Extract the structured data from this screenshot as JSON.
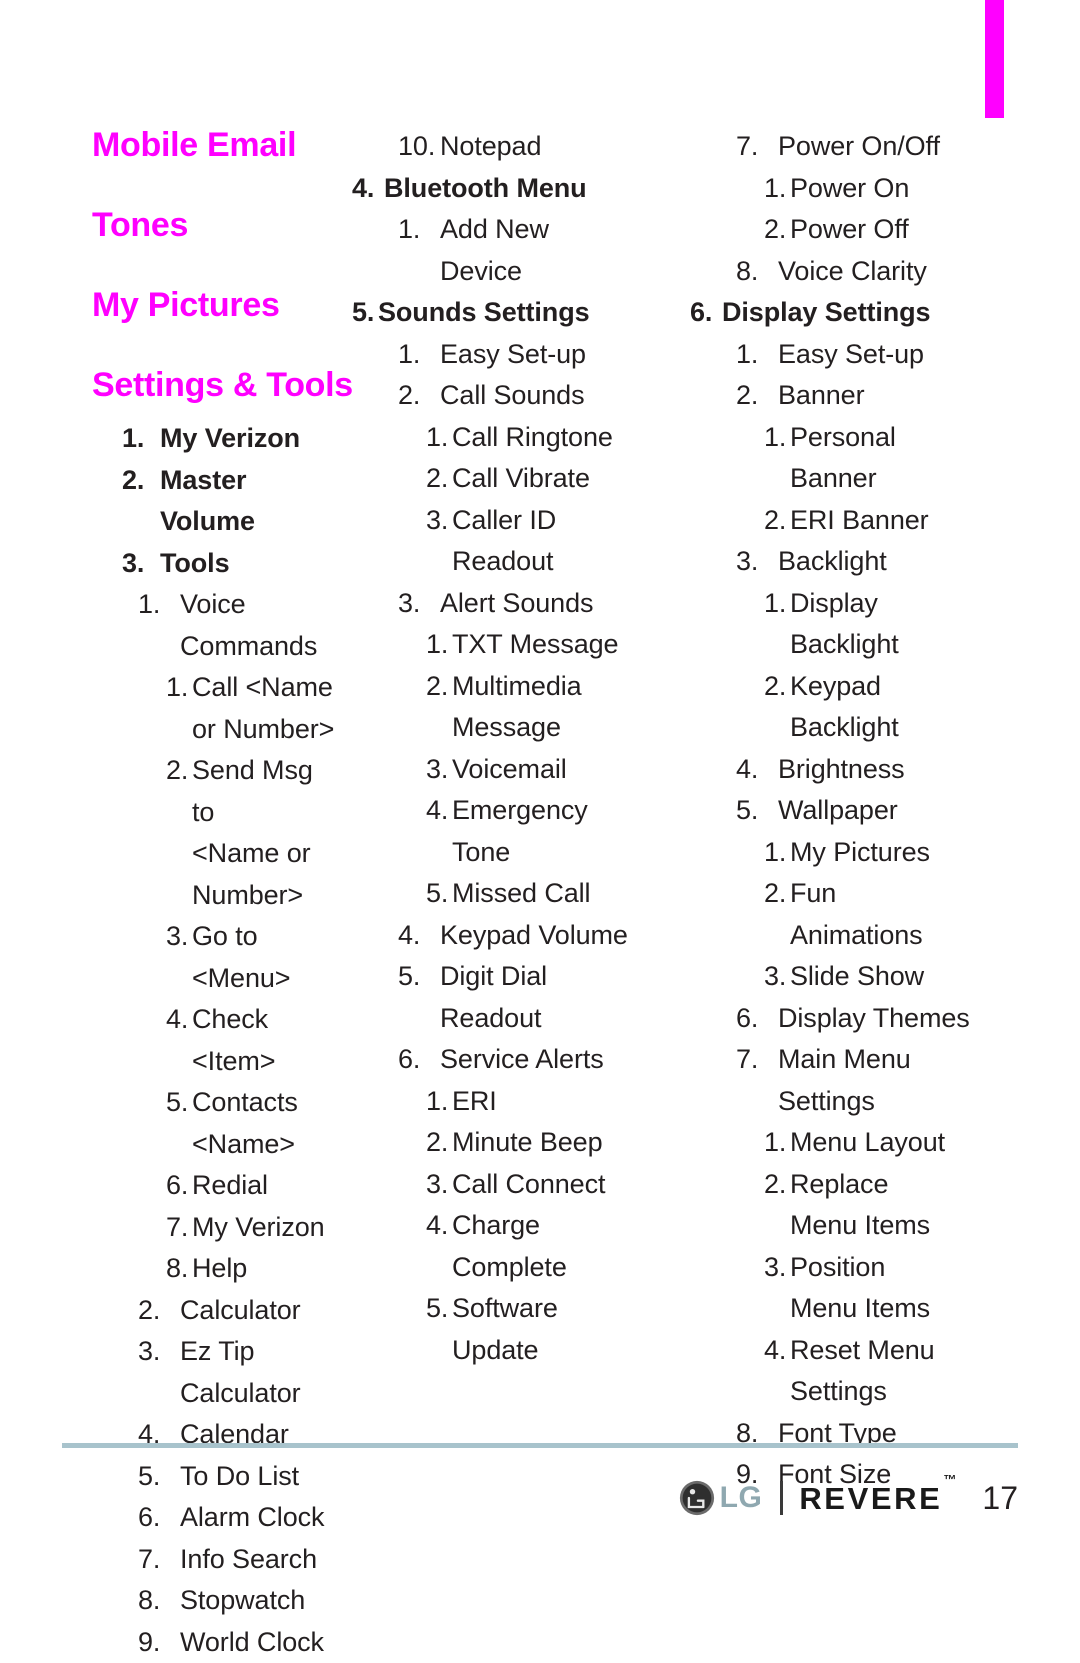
{
  "page": {
    "number": "17"
  },
  "edge_tab": {
    "color": "#ff00ff"
  },
  "columns": [
    {
      "id": "column-1",
      "headings": [
        {
          "text": "Mobile Email"
        },
        {
          "text": "Tones"
        },
        {
          "text": "My Pictures"
        },
        {
          "text": "Settings & Tools"
        }
      ],
      "entries": [
        {
          "level": 1,
          "num": "1.",
          "text": "My Verizon"
        },
        {
          "level": 1,
          "num": "2.",
          "text": "Master Volume"
        },
        {
          "level": 1,
          "num": "3.",
          "text": "Tools"
        },
        {
          "level": 2,
          "num": "1.",
          "text": "Voice"
        },
        {
          "level": "cont2",
          "text": "Commands"
        },
        {
          "level": 3,
          "num": "1.",
          "text": "Call <Name"
        },
        {
          "level": "cont3",
          "text": "or Number>"
        },
        {
          "level": 3,
          "num": "2.",
          "text": "Send Msg to"
        },
        {
          "level": "cont3",
          "text": "<Name or"
        },
        {
          "level": "cont3",
          "text": "Number>"
        },
        {
          "level": 3,
          "num": "3.",
          "text": "Go to"
        },
        {
          "level": "cont3",
          "text": "<Menu>"
        },
        {
          "level": 3,
          "num": "4.",
          "text": "Check <Item>"
        },
        {
          "level": 3,
          "num": "5.",
          "text": "Contacts"
        },
        {
          "level": "cont3",
          "text": "<Name>"
        },
        {
          "level": 3,
          "num": "6.",
          "text": "Redial"
        },
        {
          "level": 3,
          "num": "7.",
          "text": "My Verizon"
        },
        {
          "level": 3,
          "num": "8.",
          "text": "Help"
        },
        {
          "level": 2,
          "num": "2.",
          "text": "Calculator"
        },
        {
          "level": 2,
          "num": "3.",
          "text": "Ez Tip"
        },
        {
          "level": "cont2",
          "text": "Calculator"
        },
        {
          "level": 2,
          "num": "4.",
          "text": "Calendar"
        },
        {
          "level": 2,
          "num": "5.",
          "text": "To Do List"
        },
        {
          "level": 2,
          "num": "6.",
          "text": "Alarm Clock"
        },
        {
          "level": 2,
          "num": "7.",
          "text": "Info Search"
        },
        {
          "level": 2,
          "num": "8.",
          "text": "Stopwatch"
        },
        {
          "level": 2,
          "num": "9.",
          "text": "World Clock"
        }
      ]
    },
    {
      "id": "column-2",
      "headings": [],
      "entries": [
        {
          "level": 2,
          "num": "10.",
          "text": "Notepad",
          "variant": "tight"
        },
        {
          "level": 1,
          "num": "4.",
          "text": "Bluetooth Menu",
          "variant": "flush"
        },
        {
          "level": 2,
          "num": "1.",
          "text": "Add New"
        },
        {
          "level": "cont2",
          "text": "Device"
        },
        {
          "level": 1,
          "num": "5.",
          "text": "Sounds Settings",
          "variant": "flush tight"
        },
        {
          "level": 2,
          "num": "1.",
          "text": "Easy Set-up"
        },
        {
          "level": 2,
          "num": "2.",
          "text": "Call Sounds"
        },
        {
          "level": 3,
          "num": "1.",
          "text": "Call Ringtone"
        },
        {
          "level": 3,
          "num": "2.",
          "text": "Call Vibrate"
        },
        {
          "level": 3,
          "num": "3.",
          "text": "Caller ID"
        },
        {
          "level": "cont3",
          "text": "Readout"
        },
        {
          "level": 2,
          "num": "3.",
          "text": "Alert Sounds"
        },
        {
          "level": 3,
          "num": "1.",
          "text": "TXT Message"
        },
        {
          "level": 3,
          "num": "2.",
          "text": "Multimedia"
        },
        {
          "level": "cont3",
          "text": "Message"
        },
        {
          "level": 3,
          "num": "3.",
          "text": "Voicemail"
        },
        {
          "level": 3,
          "num": "4.",
          "text": "Emergency"
        },
        {
          "level": "cont3",
          "text": "Tone"
        },
        {
          "level": 3,
          "num": "5.",
          "text": "Missed Call"
        },
        {
          "level": 2,
          "num": "4.",
          "text": "Keypad Volume"
        },
        {
          "level": 2,
          "num": "5.",
          "text": "Digit Dial"
        },
        {
          "level": "cont2",
          "text": "Readout"
        },
        {
          "level": 2,
          "num": "6.",
          "text": "Service Alerts"
        },
        {
          "level": 3,
          "num": "1.",
          "text": "ERI"
        },
        {
          "level": 3,
          "num": "2.",
          "text": "Minute Beep"
        },
        {
          "level": 3,
          "num": "3.",
          "text": "Call Connect"
        },
        {
          "level": 3,
          "num": "4.",
          "text": "Charge"
        },
        {
          "level": "cont3",
          "text": "Complete"
        },
        {
          "level": 3,
          "num": "5.",
          "text": "Software"
        },
        {
          "level": "cont3",
          "text": "Update"
        }
      ]
    },
    {
      "id": "column-3",
      "headings": [],
      "entries": [
        {
          "level": 2,
          "num": "7.",
          "text": "Power On/Off"
        },
        {
          "level": 3,
          "num": "1.",
          "text": "Power On"
        },
        {
          "level": 3,
          "num": "2.",
          "text": "Power Off"
        },
        {
          "level": 2,
          "num": "8.",
          "text": "Voice Clarity"
        },
        {
          "level": 1,
          "num": "6.",
          "text": "Display Settings",
          "variant": "flush"
        },
        {
          "level": 2,
          "num": "1.",
          "text": "Easy Set-up"
        },
        {
          "level": 2,
          "num": "2.",
          "text": "Banner"
        },
        {
          "level": 3,
          "num": "1.",
          "text": "Personal"
        },
        {
          "level": "cont3",
          "text": "Banner"
        },
        {
          "level": 3,
          "num": "2.",
          "text": "ERI Banner"
        },
        {
          "level": 2,
          "num": "3.",
          "text": "Backlight"
        },
        {
          "level": 3,
          "num": "1.",
          "text": "Display"
        },
        {
          "level": "cont3",
          "text": "Backlight"
        },
        {
          "level": 3,
          "num": "2.",
          "text": "Keypad"
        },
        {
          "level": "cont3",
          "text": "Backlight"
        },
        {
          "level": 2,
          "num": "4.",
          "text": "Brightness"
        },
        {
          "level": 2,
          "num": "5.",
          "text": "Wallpaper"
        },
        {
          "level": 3,
          "num": "1.",
          "text": "My Pictures"
        },
        {
          "level": 3,
          "num": "2.",
          "text": "Fun"
        },
        {
          "level": "cont3",
          "text": "Animations"
        },
        {
          "level": 3,
          "num": "3.",
          "text": "Slide Show"
        },
        {
          "level": 2,
          "num": "6.",
          "text": "Display Themes"
        },
        {
          "level": 2,
          "num": "7.",
          "text": "Main Menu"
        },
        {
          "level": "cont2",
          "text": "Settings"
        },
        {
          "level": 3,
          "num": "1.",
          "text": "Menu Layout"
        },
        {
          "level": 3,
          "num": "2.",
          "text": "Replace"
        },
        {
          "level": "cont3",
          "text": "Menu Items"
        },
        {
          "level": 3,
          "num": "3.",
          "text": "Position"
        },
        {
          "level": "cont3",
          "text": "Menu Items"
        },
        {
          "level": 3,
          "num": "4.",
          "text": "Reset Menu"
        },
        {
          "level": "cont3",
          "text": "Settings"
        },
        {
          "level": 2,
          "num": "8.",
          "text": "Font Type"
        },
        {
          "level": 2,
          "num": "9.",
          "text": "Font Size"
        }
      ]
    }
  ],
  "footer": {
    "brand": "LG",
    "product": "REVERE",
    "trademark": "™",
    "page_number": "17"
  }
}
